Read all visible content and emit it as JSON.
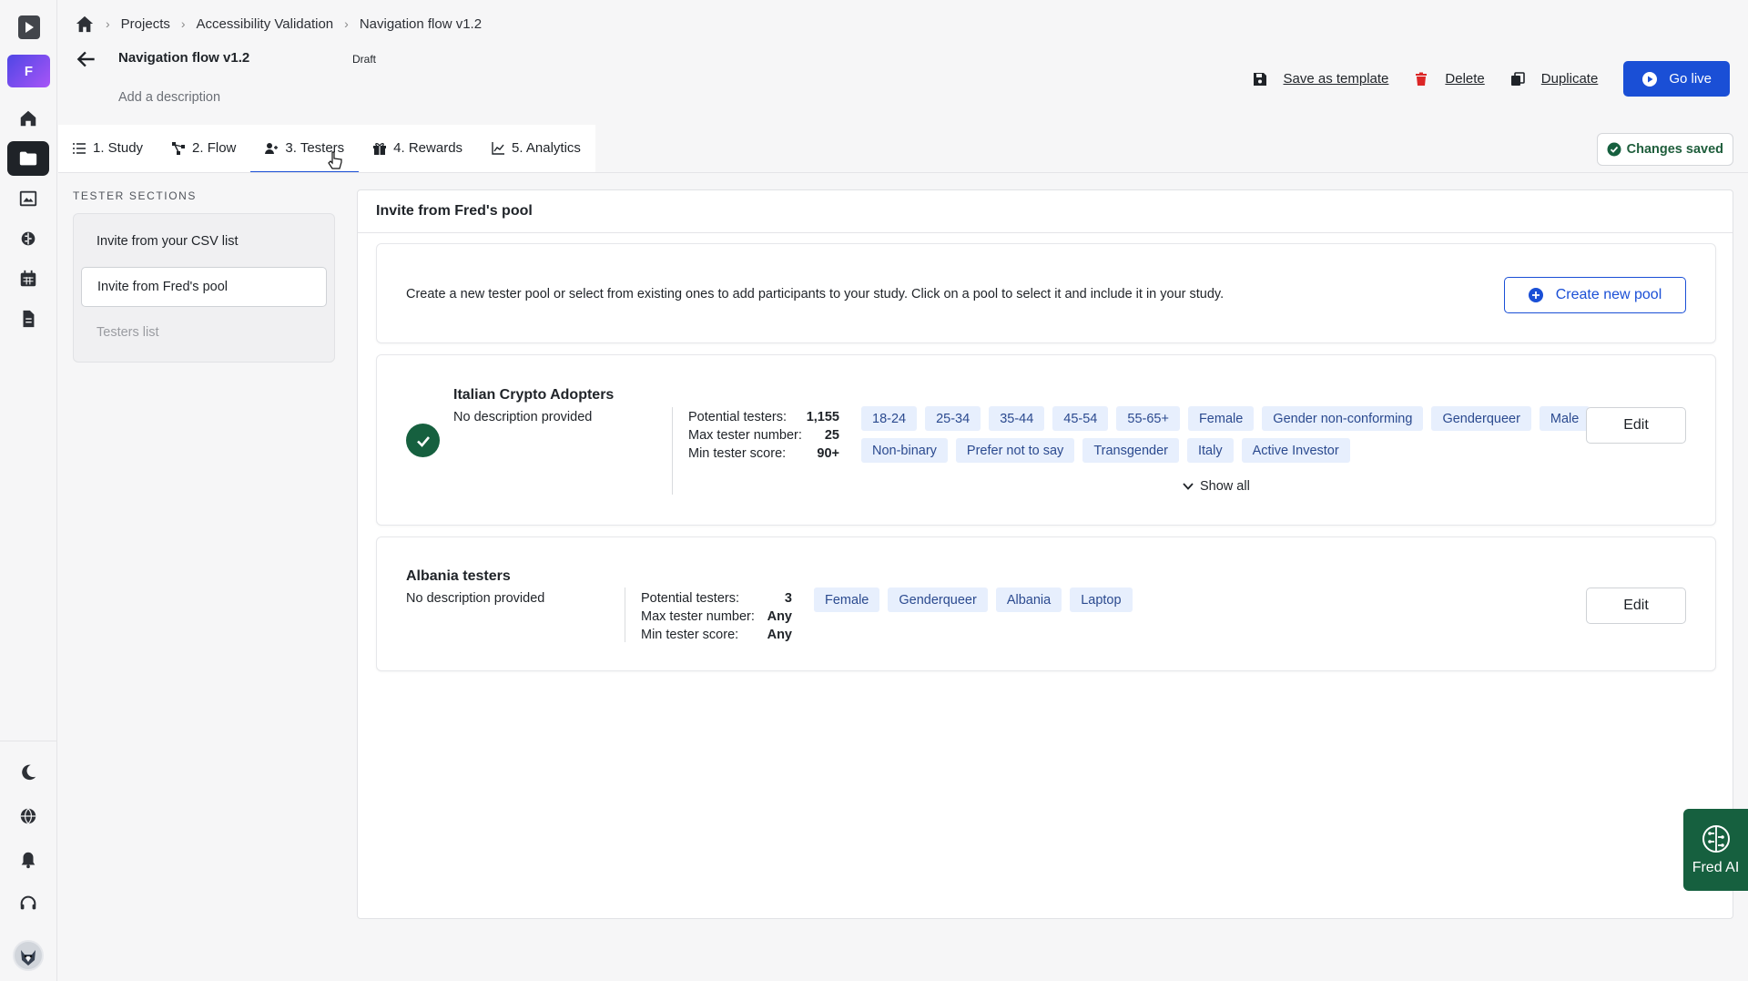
{
  "rail": {
    "org_initial": "F",
    "items": [
      {
        "name": "home-icon"
      },
      {
        "name": "folder-icon",
        "active": true
      },
      {
        "name": "media-icon"
      },
      {
        "name": "brain-icon"
      },
      {
        "name": "calendar-icon"
      },
      {
        "name": "document-icon"
      }
    ],
    "bottom": [
      "moon-icon",
      "globe-icon",
      "bell-icon",
      "headset-icon"
    ]
  },
  "breadcrumb": {
    "items": [
      "Projects",
      "Accessibility Validation",
      "Navigation flow v1.2"
    ]
  },
  "header": {
    "title": "Navigation flow v1.2",
    "status": "Draft",
    "description_placeholder": "Add a description"
  },
  "actions": {
    "save_template": "Save as template",
    "delete": "Delete",
    "duplicate": "Duplicate",
    "go_live": "Go live"
  },
  "tabs": [
    {
      "label": "1. Study",
      "icon": "list-icon"
    },
    {
      "label": "2. Flow",
      "icon": "flow-icon"
    },
    {
      "label": "3. Testers",
      "icon": "user-add-icon",
      "active": true
    },
    {
      "label": "4. Rewards",
      "icon": "gift-icon"
    },
    {
      "label": "5. Analytics",
      "icon": "chart-icon"
    }
  ],
  "save_status": "Changes saved",
  "sections": {
    "label": "TESTER SECTIONS",
    "items": [
      {
        "label": "Invite from your CSV list"
      },
      {
        "label": "Invite from Fred's pool",
        "active": true
      },
      {
        "label": "Testers list",
        "disabled": true
      }
    ]
  },
  "panel": {
    "title": "Invite from Fred's pool",
    "intro": "Create a new tester pool or select from existing ones to add participants to your study. Click on a pool to select it and include it in your study.",
    "create_button": "Create new pool",
    "stat_labels": {
      "potential": "Potential testers:",
      "max": "Max tester number:",
      "min_score": "Min tester score:"
    },
    "edit_label": "Edit",
    "show_all": "Show all",
    "pools": [
      {
        "name": "Italian Crypto Adopters",
        "description": "No description provided",
        "selected": true,
        "potential": "1,155",
        "max": "25",
        "min_score": "90+",
        "tags": [
          "18-24",
          "25-34",
          "35-44",
          "45-54",
          "55-65+",
          "Female",
          "Gender non-conforming",
          "Genderqueer",
          "Male",
          "Non-binary",
          "Prefer not to say",
          "Transgender",
          "Italy",
          "Active Investor"
        ]
      },
      {
        "name": "Albania testers",
        "description": "No description provided",
        "selected": false,
        "potential": "3",
        "max": "Any",
        "min_score": "Any",
        "tags": [
          "Female",
          "Genderqueer",
          "Albania",
          "Laptop"
        ]
      }
    ]
  },
  "fred_ai": "Fred AI"
}
